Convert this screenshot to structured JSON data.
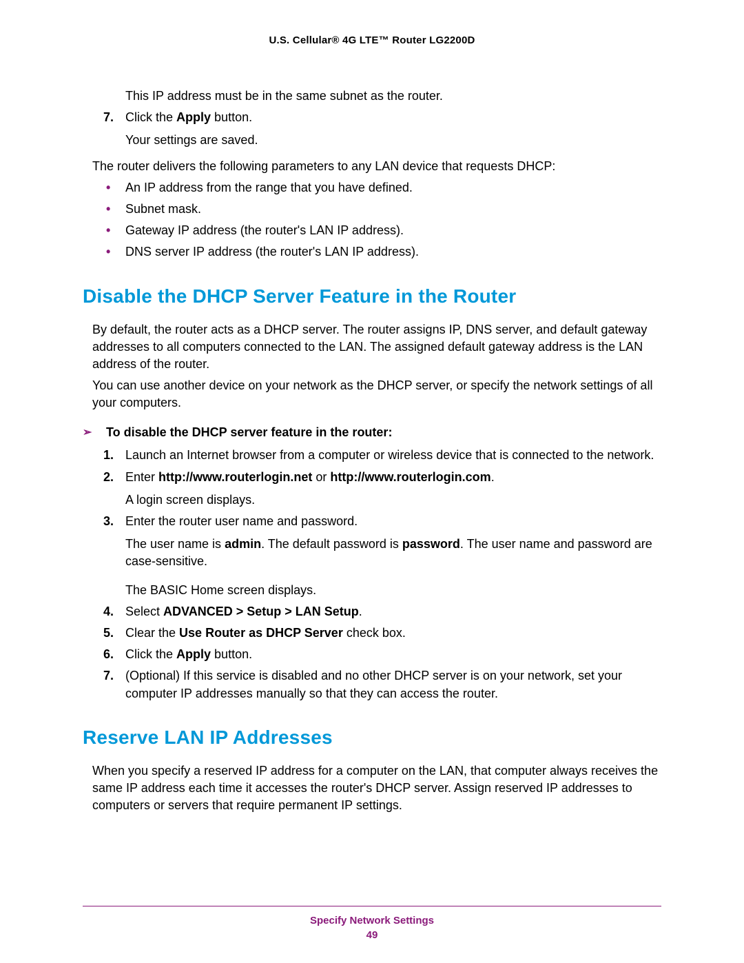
{
  "header": {
    "title": "U.S. Cellular® 4G LTE™ Router LG2200D"
  },
  "intro": {
    "subnet_note": "This IP address must be in the same subnet as the router.",
    "step7_prefix": "Click the ",
    "step7_bold": "Apply",
    "step7_suffix": " button.",
    "step7_sub": "Your settings are saved.",
    "dhcp_intro": "The router delivers the following parameters to any LAN device that requests DHCP:",
    "bullets": [
      "An IP address from the range that you have defined.",
      "Subnet mask.",
      "Gateway IP address (the router's LAN IP address).",
      "DNS server IP address (the router's LAN IP address)."
    ]
  },
  "section1": {
    "heading": "Disable the DHCP Server Feature in the Router",
    "p1": "By default, the router acts as a DHCP server. The router assigns IP, DNS server, and default gateway addresses to all computers connected to the LAN. The assigned default gateway address is the LAN address of the router.",
    "p2": "You can use another device on your network as the DHCP server, or specify the network settings of all your computers.",
    "proc": "To disable the DHCP server feature in the router:",
    "steps": {
      "s1": "Launch an Internet browser from a computer or wireless device that is connected to the network.",
      "s2_a": "Enter ",
      "s2_b": "http://www.routerlogin.net",
      "s2_c": " or ",
      "s2_d": "http://www.routerlogin.com",
      "s2_e": ".",
      "s2_sub": "A login screen displays.",
      "s3": "Enter the router user name and password.",
      "s3_sub_a": "The user name is ",
      "s3_sub_b": "admin",
      "s3_sub_c": ". The default password is ",
      "s3_sub_d": "password",
      "s3_sub_e": ". The user name and password are case-sensitive.",
      "s3_sub2": "The BASIC Home screen displays.",
      "s4_a": "Select ",
      "s4_b": "ADVANCED > Setup > LAN Setup",
      "s4_c": ".",
      "s5_a": "Clear the ",
      "s5_b": "Use Router as DHCP Server",
      "s5_c": " check box.",
      "s6_a": "Click the ",
      "s6_b": "Apply",
      "s6_c": " button.",
      "s7": "(Optional) If this service is disabled and no other DHCP server is on your network, set your computer IP addresses manually so that they can access the router."
    }
  },
  "section2": {
    "heading": "Reserve LAN IP Addresses",
    "p1": "When you specify a reserved IP address for a computer on the LAN, that computer always receives the same IP address each time it accesses the router's DHCP server. Assign reserved IP addresses to computers or servers that require permanent IP settings."
  },
  "footer": {
    "section": "Specify Network Settings",
    "page": "49"
  }
}
